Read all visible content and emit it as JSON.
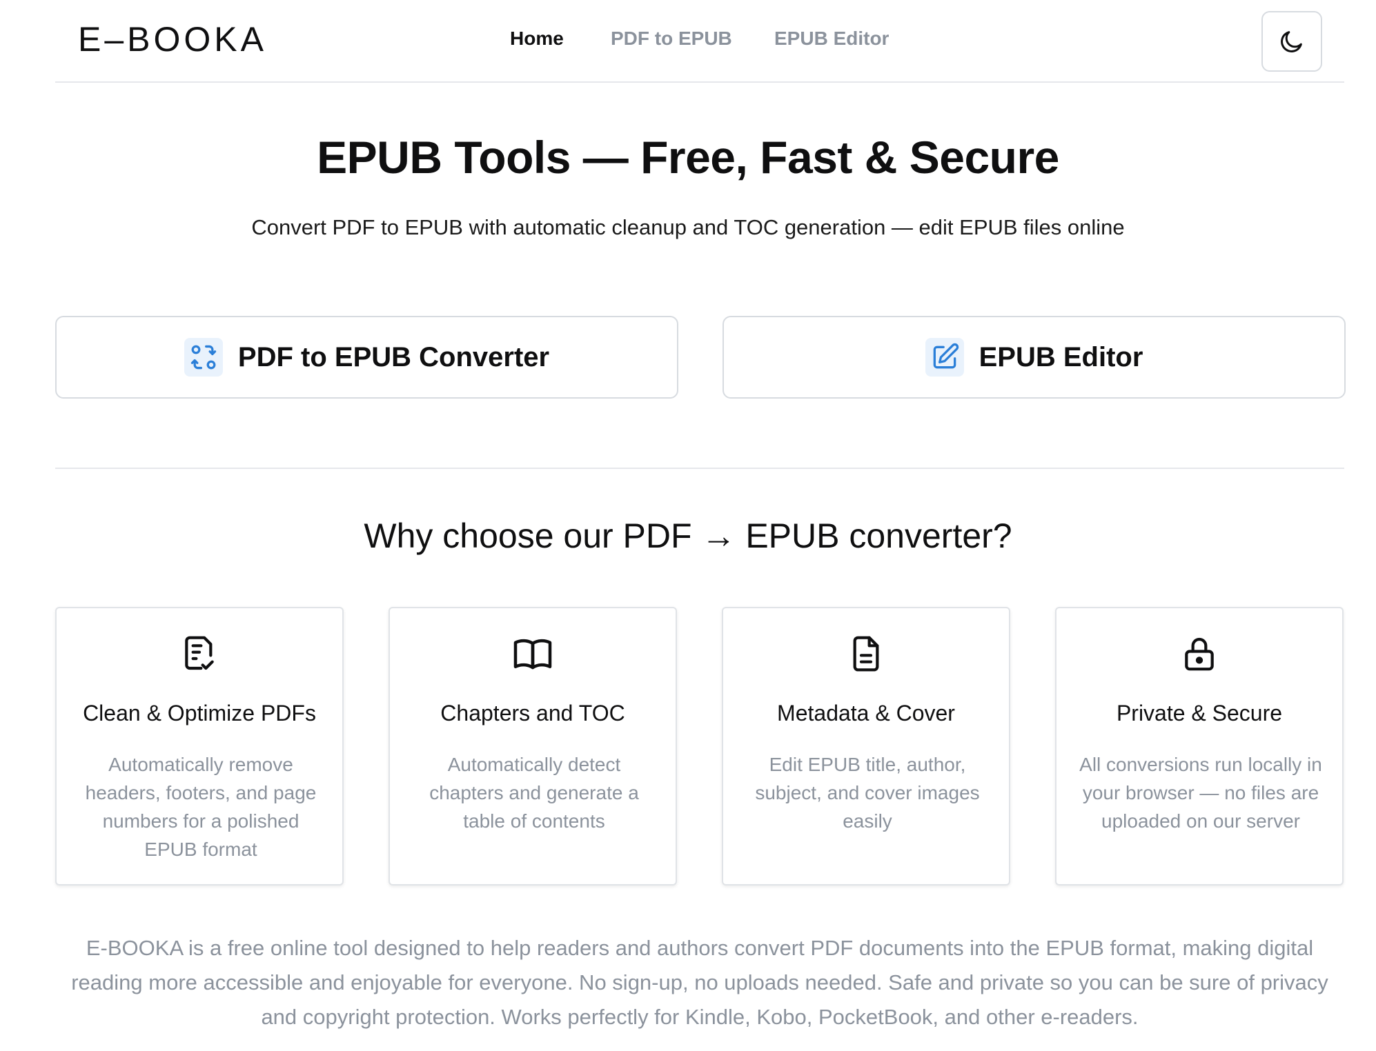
{
  "header": {
    "logo": "E–BOOKA",
    "nav": [
      {
        "label": "Home",
        "active": true
      },
      {
        "label": "PDF to EPUB",
        "active": false
      },
      {
        "label": "EPUB Editor",
        "active": false
      }
    ],
    "theme_toggle_icon": "moon-icon"
  },
  "hero": {
    "title": "EPUB Tools — Free, Fast & Secure",
    "subtitle": "Convert PDF to EPUB with automatic cleanup and TOC generation — edit EPUB files online"
  },
  "tools": [
    {
      "label": "PDF to EPUB Converter",
      "icon": "convert-arrows-icon"
    },
    {
      "label": "EPUB Editor",
      "icon": "edit-pencil-icon"
    }
  ],
  "why": {
    "heading": "Why choose our PDF → EPUB converter?"
  },
  "features": [
    {
      "title": "Clean & Optimize PDFs",
      "description": "Automatically remove headers, footers, and page numbers for a polished EPUB format",
      "icon": "document-check-icon"
    },
    {
      "title": "Chapters and TOC",
      "description": "Automatically detect chapters and generate a table of contents",
      "icon": "open-book-icon"
    },
    {
      "title": "Metadata & Cover",
      "description": "Edit EPUB title, author, subject, and cover images easily",
      "icon": "file-text-icon"
    },
    {
      "title": "Private & Secure",
      "description": "All conversions run locally in your browser — no files are uploaded on our server",
      "icon": "lock-icon"
    }
  ],
  "about": "E-BOOKA is a free online tool designed to help readers and authors convert PDF documents into the EPUB format, making digital reading more accessible and enjoyable for everyone. No sign-up, no uploads needed. Safe and private so you can be sure of privacy and copyright protection. Works perfectly for Kindle, Kobo, PocketBook, and other e-readers.",
  "colors": {
    "accent": "#2b7fd8",
    "accent_bg": "#e9f2fc",
    "muted_text": "#8b929c",
    "border": "#d7dbe0"
  }
}
